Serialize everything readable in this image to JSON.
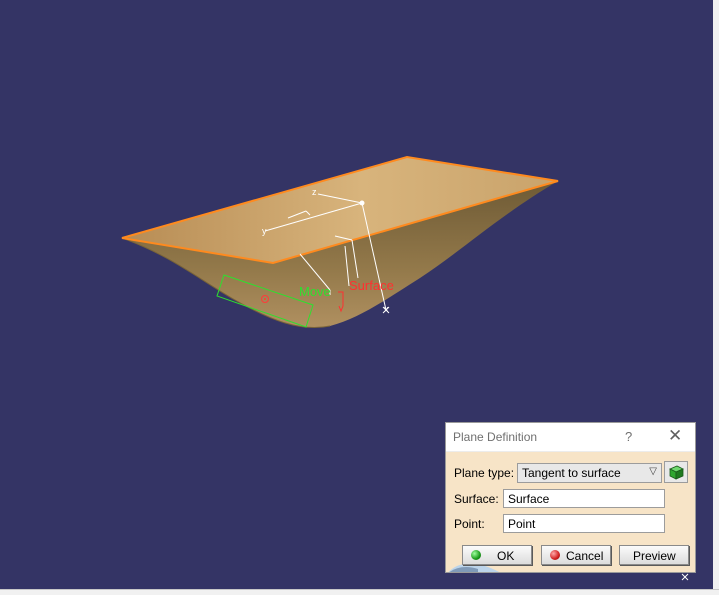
{
  "viewport": {
    "labels": {
      "move": "Move",
      "surface": "Surface",
      "axis_x": "x",
      "axis_y": "y",
      "axis_z": "z"
    }
  },
  "dialog": {
    "title": "Plane Definition",
    "help": "?",
    "close": "✕",
    "plane_type_label": "Plane type:",
    "plane_type_value": "Tangent to surface",
    "surface_label": "Surface:",
    "surface_value": "Surface",
    "point_label": "Point:",
    "point_value": "Point",
    "ok_label": "OK",
    "cancel_label": "Cancel",
    "preview_label": "Preview"
  },
  "colors": {
    "background": "#343465",
    "surface_fill": "#c9a469",
    "surface_edge": "#ff8a1e",
    "dialog_bg": "#f7e4c7"
  }
}
